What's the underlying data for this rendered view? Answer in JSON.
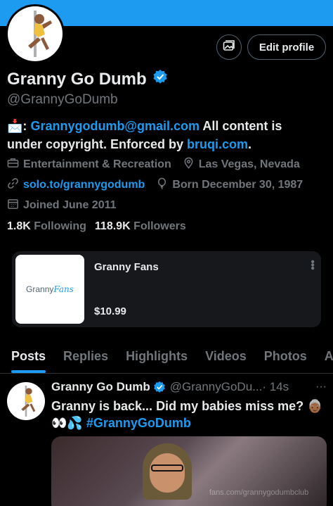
{
  "profile": {
    "name": "Granny Go Dumb",
    "handle": "@GrannyGoDumb",
    "edit_label": "Edit profile",
    "bio_parts": {
      "emoji": "📩",
      "colon": ":",
      "email": "Grannygodumb@gmail.com",
      "text1": " All content is under copyright. Enforced by ",
      "link": "bruqi.com",
      "text2": "."
    },
    "category": "Entertainment & Recreation",
    "location": "Las Vegas, Nevada",
    "website": "solo.to/grannygodumb",
    "born": "Born December 30, 1987",
    "joined": "Joined June 2011",
    "following_count": "1.8K",
    "following_label": "Following",
    "followers_count": "118.9K",
    "followers_label": "Followers"
  },
  "shop": {
    "title": "Granny Fans",
    "price": "$10.99",
    "logo_text_1": "Granny",
    "logo_text_2": "Fans",
    "more": "⋮"
  },
  "tabs": [
    "Posts",
    "Replies",
    "Highlights",
    "Videos",
    "Photos",
    "Ar"
  ],
  "post": {
    "name": "Granny Go Dumb",
    "handle": "@GrannyGoDu...",
    "time": "· 14s",
    "more": "···",
    "text_line1": "Granny is back... Did my babies miss me? 👵🏾",
    "text_line2_emoji": "👀💦",
    "hashtag": "#GrannyGoDumb",
    "media_watermark": "fans.com/grannygodumbclub"
  },
  "colors": {
    "accent": "#1d9bf0",
    "background": "#000000",
    "muted": "#71767b"
  }
}
